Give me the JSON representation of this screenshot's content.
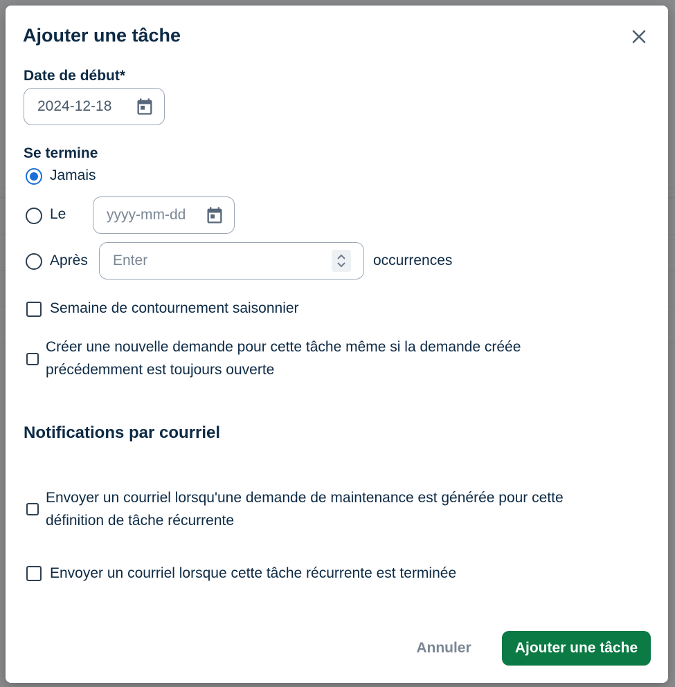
{
  "modal": {
    "title": "Ajouter une tâche",
    "close_icon": "close-icon"
  },
  "start_date": {
    "label": "Date de début*",
    "value": "2024-12-18",
    "icon": "calendar-icon"
  },
  "ends": {
    "label": "Se termine",
    "never_label": "Jamais",
    "never_selected": true,
    "on_label": "Le",
    "on_placeholder": "yyyy-mm-dd",
    "after_label": "Après",
    "after_placeholder": "Enter",
    "after_suffix": "occurrences"
  },
  "options": {
    "seasonal_bypass": "Semaine de contournement saisonnier",
    "new_request_line1": "Créer une nouvelle demande pour cette tâche même si la demande créée",
    "new_request_line2": "précédemment est toujours ouverte"
  },
  "notifications": {
    "title": "Notifications par courriel",
    "on_generated_line1": "Envoyer un courriel lorsqu'une demande de maintenance est générée pour cette",
    "on_generated_line2": "définition de tâche récurrente",
    "on_completed": "Envoyer un courriel lorsque cette tâche récurrente est terminée"
  },
  "footer": {
    "cancel_label": "Annuler",
    "submit_label": "Ajouter une tâche"
  },
  "colors": {
    "primary": "#0b7a44",
    "radio_selected": "#1c6fd6",
    "text": "#0d2a45"
  }
}
